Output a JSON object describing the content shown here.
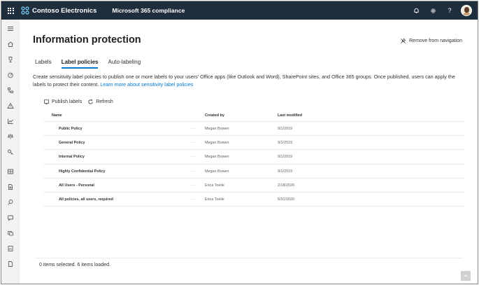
{
  "topbar": {
    "brand_name": "Contoso Electronics",
    "app_name": "Microsoft 365 compliance",
    "bg_color": "#1f2e3d"
  },
  "page": {
    "title": "Information protection",
    "remove_nav_label": "Remove from navigation"
  },
  "tabs": [
    {
      "label": "Labels",
      "active": false
    },
    {
      "label": "Label policies",
      "active": true
    },
    {
      "label": "Auto-labeling",
      "active": false
    }
  ],
  "description": {
    "text": "Create sensitivity label policies to publish one or more labels to your users' Office apps (like Outlook and Word), SharePoint sites, and Office 365 groups. Once published, users can apply the labels to protect their content.",
    "link_text": "Learn more about sensitivity label policies"
  },
  "toolbar": {
    "publish_label": "Publish labels",
    "refresh_label": "Refresh"
  },
  "table": {
    "headers": {
      "name": "Name",
      "created_by": "Created by",
      "last_modified": "Last modified"
    },
    "rows": [
      {
        "name": "Public Policy",
        "more": "···",
        "created_by": "Megan Bowen",
        "last_modified": "9/1/2019"
      },
      {
        "name": "General Policy",
        "more": "···",
        "created_by": "Megan Bowen",
        "last_modified": "9/1/2019"
      },
      {
        "name": "Internal Policy",
        "more": "···",
        "created_by": "Megan Bowen",
        "last_modified": "9/1/2019"
      },
      {
        "name": "Highly Confidential Policy",
        "more": "···",
        "created_by": "Megan Bowen",
        "last_modified": "9/1/2019"
      },
      {
        "name": "All Users - Personal",
        "more": "···",
        "created_by": "Erica Toelle",
        "last_modified": "2/18/2020"
      },
      {
        "name": "All policies, all users, required",
        "more": "···",
        "created_by": "Erica Toelle",
        "last_modified": "5/31/2020"
      }
    ]
  },
  "footer": {
    "status": "0 items selected.  6 items loaded."
  },
  "icons": {
    "waffle": "app-launcher-icon",
    "brand": "contoso-logo-icon",
    "notifications": "bell-icon",
    "settings": "gear-icon",
    "help": "help-icon"
  },
  "colors": {
    "accent": "#0078d4",
    "text": "#201f1e"
  }
}
